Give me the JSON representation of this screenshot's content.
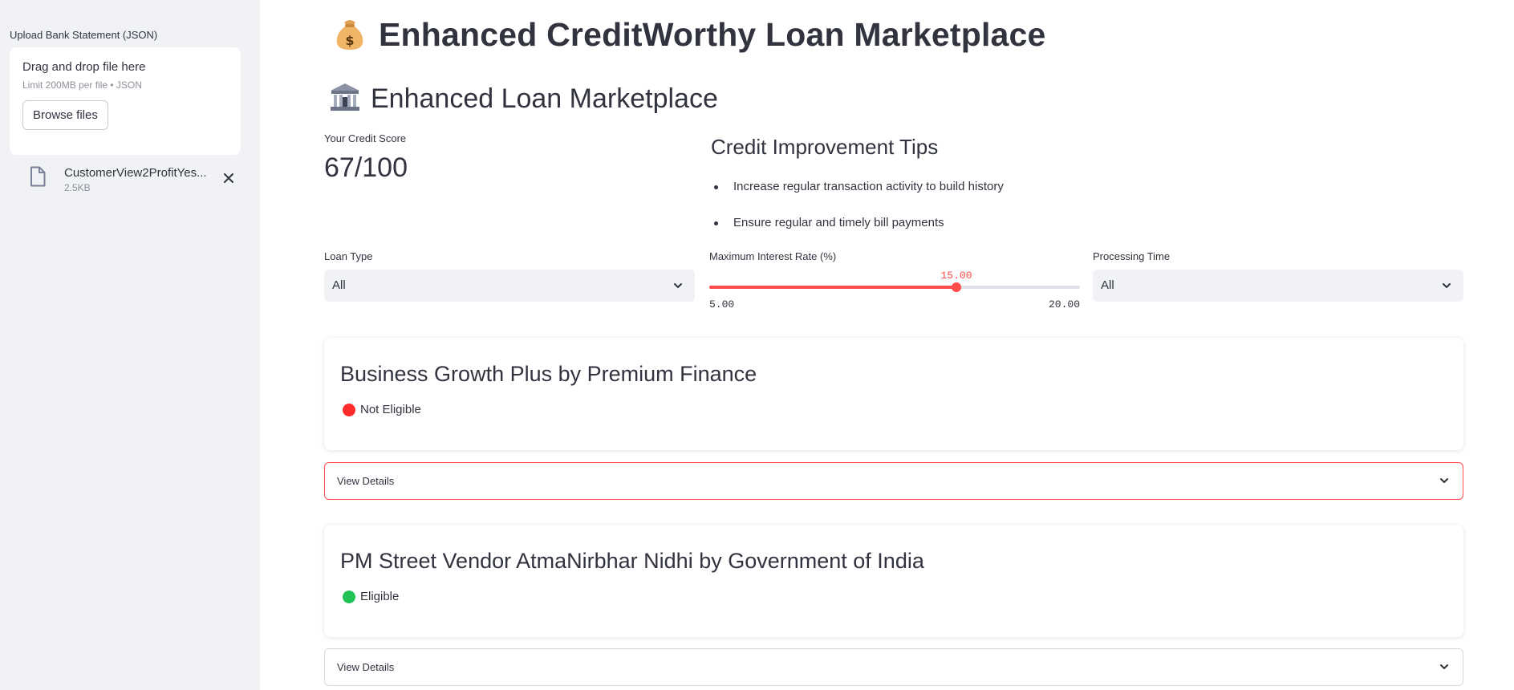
{
  "sidebar": {
    "upload_label": "Upload Bank Statement (JSON)",
    "drop_title": "Drag and drop file here",
    "drop_limit": "Limit 200MB per file • JSON",
    "browse_label": "Browse files",
    "file": {
      "name": "CustomerView2ProfitYes...",
      "size": "2.5KB",
      "close_icon": "close-icon"
    }
  },
  "header": {
    "icon": "money-bag-icon",
    "title": "Enhanced CreditWorthy Loan Marketplace",
    "subtitle_icon": "bank-icon",
    "subtitle": "Enhanced Loan Marketplace"
  },
  "score": {
    "label": "Your Credit Score",
    "value": "67/100"
  },
  "tips": {
    "title": "Credit Improvement Tips",
    "items": [
      "Increase regular transaction activity to build history",
      "Ensure regular and timely bill payments"
    ]
  },
  "filters": {
    "loan_type": {
      "label": "Loan Type",
      "value": "All"
    },
    "interest": {
      "label": "Maximum Interest Rate (%)",
      "value": 15.0,
      "value_text": "15.00",
      "min": 5.0,
      "min_text": "5.00",
      "max": 20.0,
      "max_text": "20.00"
    },
    "processing": {
      "label": "Processing Time",
      "value": "All"
    }
  },
  "loans": [
    {
      "title": "Business Growth Plus by Premium Finance",
      "status": "Not Eligible",
      "status_color": "#ff2b2b",
      "details_label": "View Details"
    },
    {
      "title": "PM Street Vendor AtmaNirbhar Nidhi by Government of India",
      "status": "Eligible",
      "status_color": "#21c354",
      "details_label": "View Details"
    }
  ],
  "colors": {
    "accent": "#ff4b4b",
    "sidebar_bg": "#f0f2f6",
    "text": "#31333f"
  }
}
